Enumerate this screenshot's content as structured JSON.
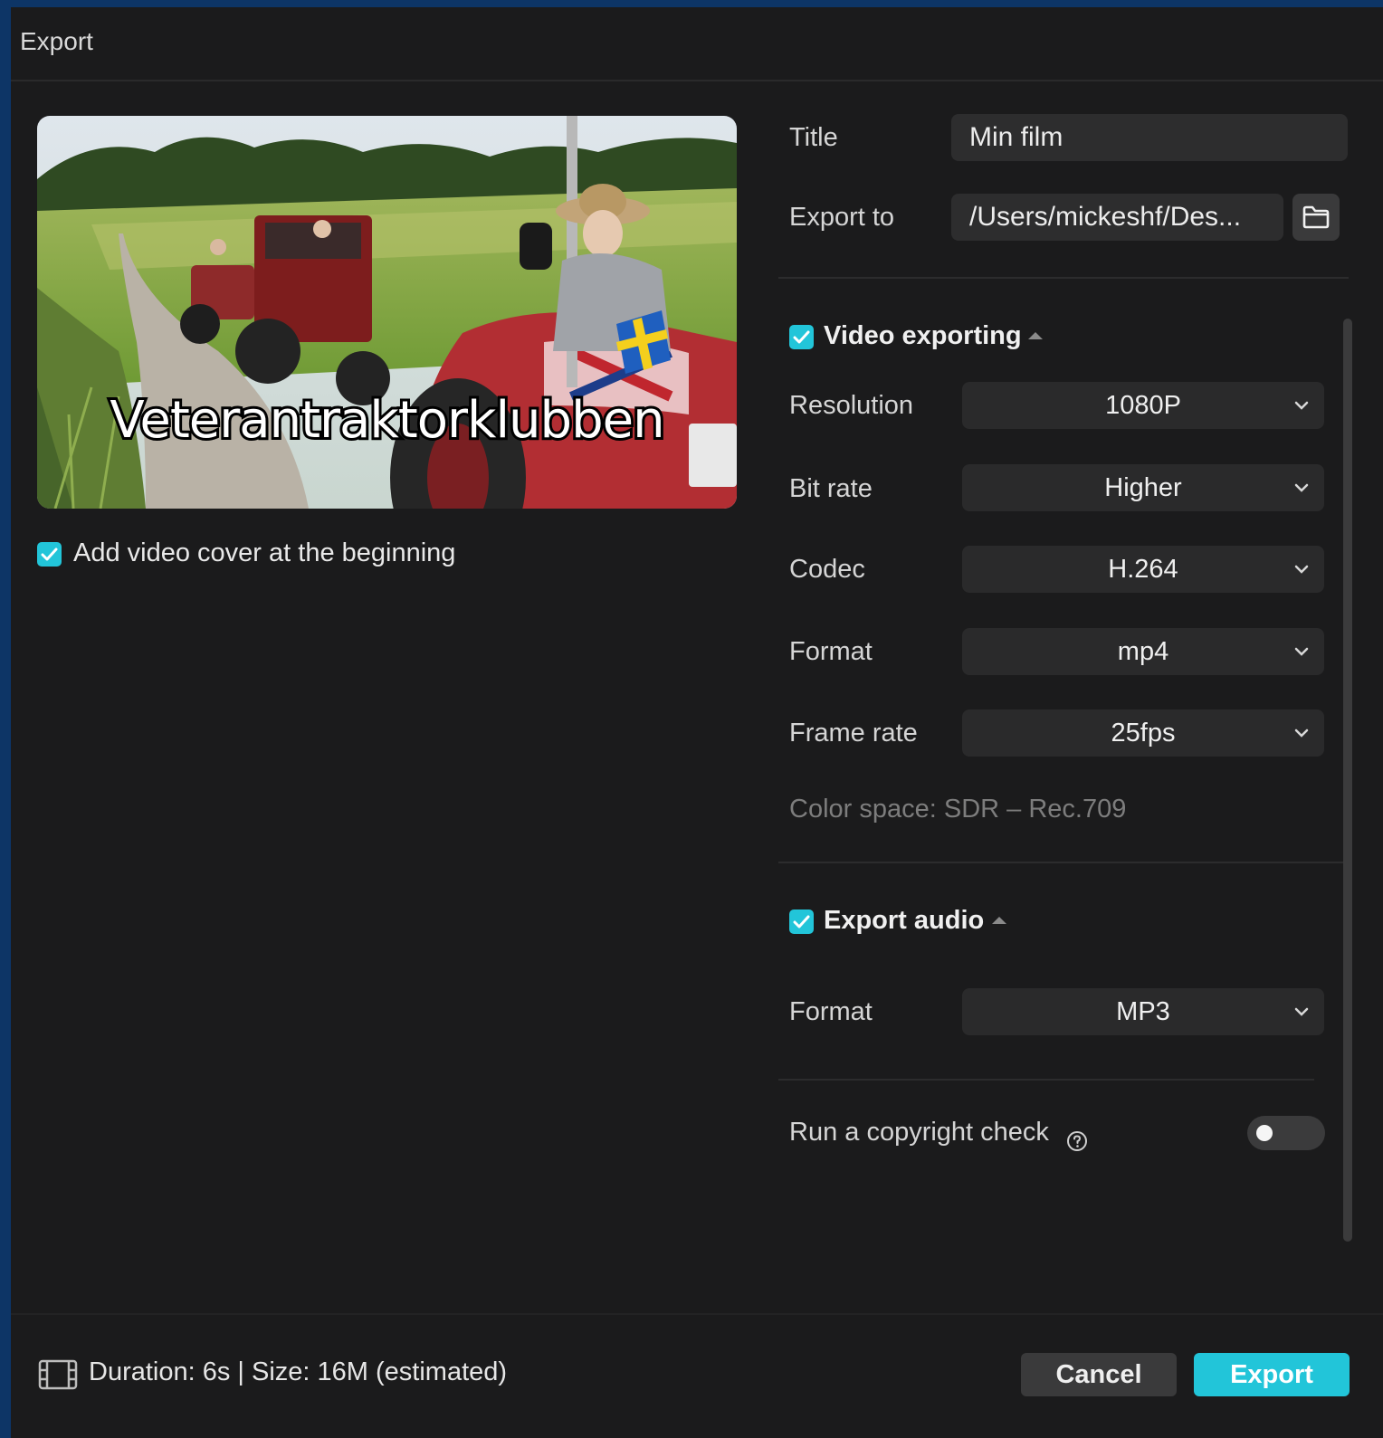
{
  "window": {
    "title": "Export"
  },
  "cover": {
    "caption": "Veterantraktorklubben",
    "add_cover_label": "Add video cover at the beginning",
    "add_cover_checked": true
  },
  "fields": {
    "title_label": "Title",
    "title_value": "Min film",
    "export_to_label": "Export to",
    "export_to_value": "/Users/mickeshf/Des..."
  },
  "video": {
    "section_label": "Video exporting",
    "checked": true,
    "resolution_label": "Resolution",
    "resolution_value": "1080P",
    "bitrate_label": "Bit rate",
    "bitrate_value": "Higher",
    "codec_label": "Codec",
    "codec_value": "H.264",
    "format_label": "Format",
    "format_value": "mp4",
    "framerate_label": "Frame rate",
    "framerate_value": "25fps",
    "color_space": "Color space: SDR – Rec.709"
  },
  "audio": {
    "section_label": "Export audio",
    "checked": true,
    "format_label": "Format",
    "format_value": "MP3"
  },
  "copyright": {
    "label": "Run a copyright check",
    "enabled": false
  },
  "footer": {
    "info": "Duration: 6s | Size: 16M (estimated)",
    "cancel_label": "Cancel",
    "export_label": "Export"
  },
  "colors": {
    "accent": "#22c5d9",
    "background": "#1b1b1c",
    "control": "#2a2a2b"
  }
}
